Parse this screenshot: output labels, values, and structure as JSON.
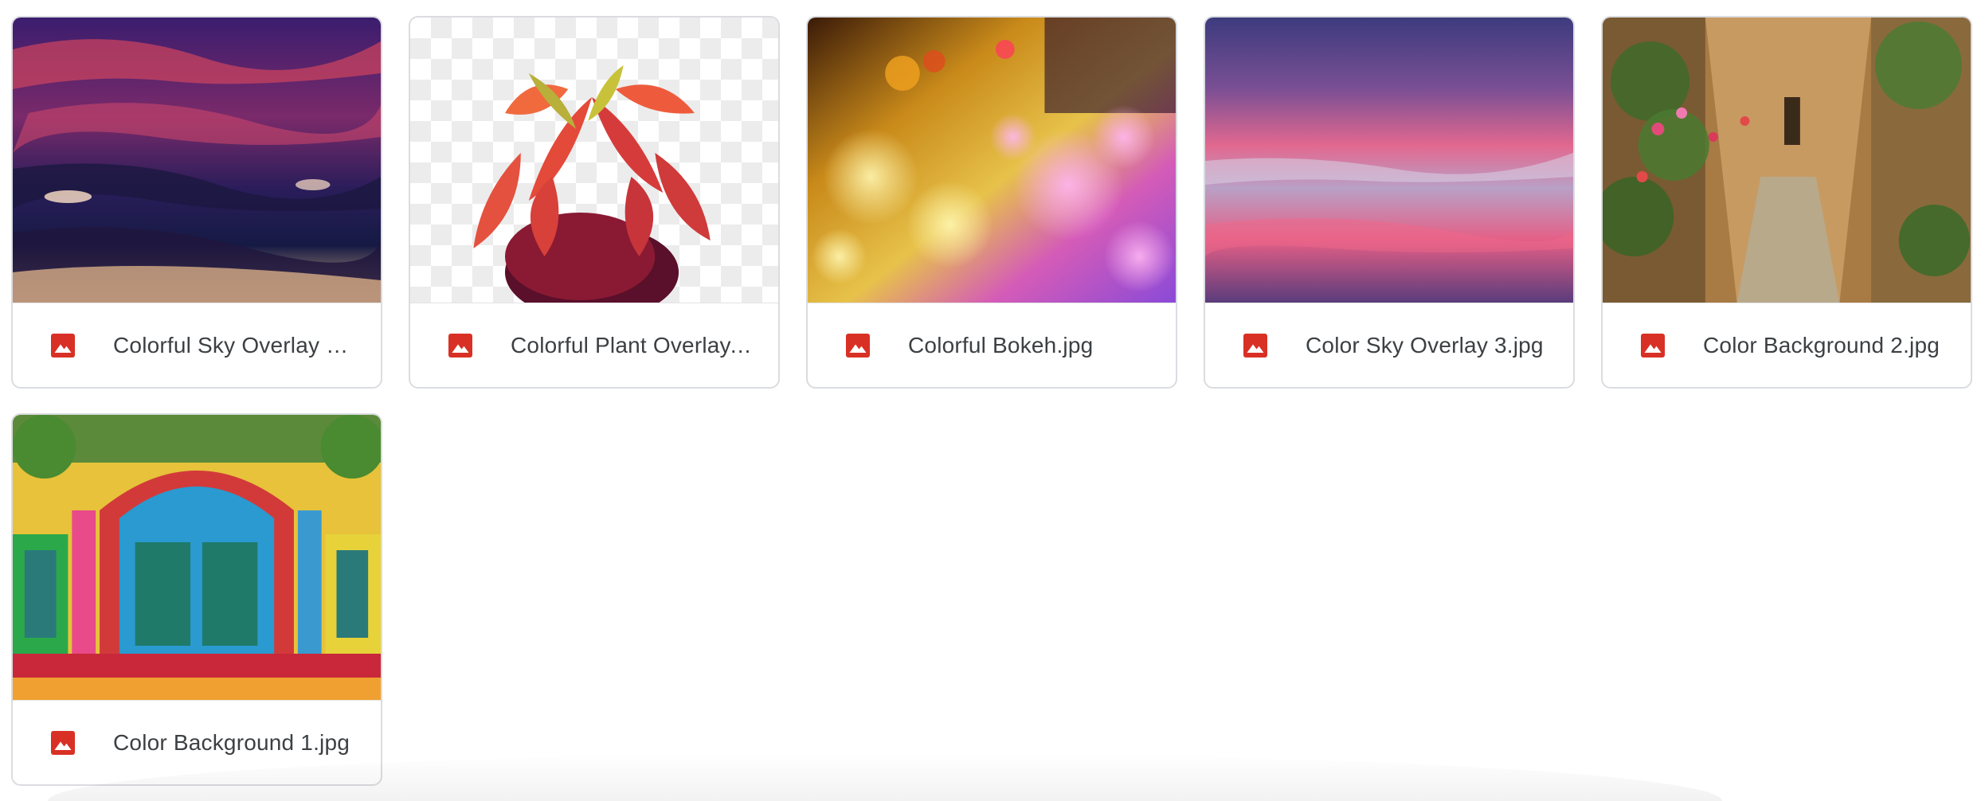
{
  "files": [
    {
      "name": "Colorful Sky Overlay 1....",
      "icon": "image-file-icon"
    },
    {
      "name": "Colorful Plant Overlay....",
      "icon": "image-file-icon"
    },
    {
      "name": "Colorful Bokeh.jpg",
      "icon": "image-file-icon"
    },
    {
      "name": "Color Sky Overlay 3.jpg",
      "icon": "image-file-icon"
    },
    {
      "name": "Color Background 2.jpg",
      "icon": "image-file-icon"
    },
    {
      "name": "Color Background 1.jpg",
      "icon": "image-file-icon"
    }
  ],
  "colors": {
    "icon_red": "#d93025",
    "text": "#3c4043",
    "border": "#dadce0"
  }
}
